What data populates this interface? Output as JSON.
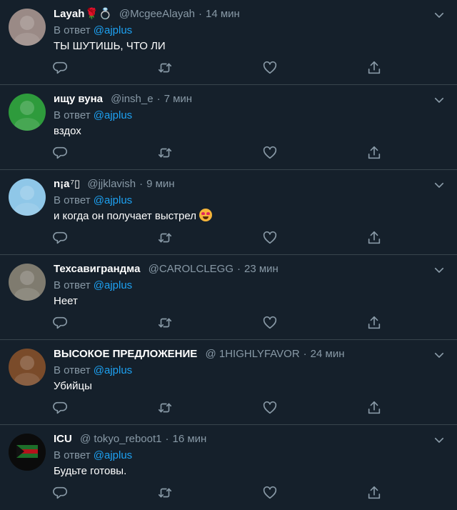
{
  "tweets": [
    {
      "name": "Layah",
      "name_extra": "🌹💍",
      "handle": "@McgeeAlayah",
      "time": "14 мин",
      "reply_prefix": "В ответ",
      "reply_to": "@ajplus",
      "text": "ТЫ ШУТИШЬ, ЧТО ЛИ",
      "avatar_color": "#9a8a86"
    },
    {
      "name": "ищу вуна",
      "name_extra": "",
      "handle": "@insh_e",
      "time": "7 мин",
      "reply_prefix": "В ответ",
      "reply_to": "@ajplus",
      "text": "вздох",
      "avatar_color": "#2e9b3c"
    },
    {
      "name": "n¡a",
      "name_extra": "⁷▯",
      "handle": "@jjklavish",
      "time": "9 мин",
      "reply_prefix": "В ответ",
      "reply_to": "@ajplus",
      "text": "и когда он получает выстрел",
      "avatar_color": "#8fc7e8"
    },
    {
      "name": "Техсавиграндма",
      "name_extra": "",
      "handle": "@CAROLCLEGG",
      "time": "23 мин",
      "reply_prefix": "В ответ",
      "reply_to": "@ajplus",
      "text": "Неет",
      "avatar_color": "#7f7b6f"
    },
    {
      "name": "ВЫСОКОЕ ПРЕДЛОЖЕНИЕ",
      "name_extra": "",
      "handle": "@ 1HIGHLYFAVOR",
      "time": "24 мин",
      "reply_prefix": "В ответ",
      "reply_to": "@ajplus",
      "text": "Убийцы",
      "avatar_color": "#7a4b2a"
    },
    {
      "name": "ICU",
      "name_extra": "",
      "handle": "@ tokyo_reboot1",
      "time": "16 мин",
      "reply_prefix": "В ответ",
      "reply_to": "@ajplus",
      "text": "Будьте готовы.",
      "avatar_color": "#111111"
    }
  ],
  "icons": {
    "reply": "reply-icon",
    "retweet": "retweet-icon",
    "like": "heart-icon",
    "share": "share-icon",
    "caret": "chevron-down-icon"
  },
  "colors": {
    "background": "#15202b",
    "divider": "#38444d",
    "muted": "#8899a6",
    "link": "#1da1f2"
  }
}
